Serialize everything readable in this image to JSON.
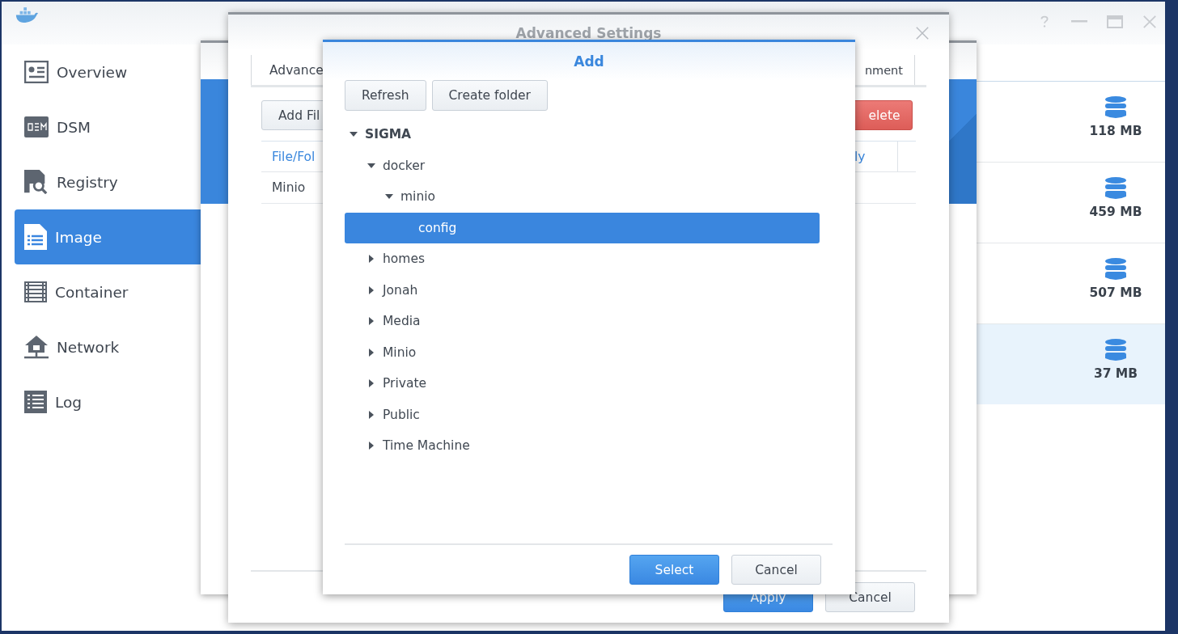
{
  "main_window": {
    "sidebar": {
      "items": [
        {
          "label": "Overview",
          "selected": false
        },
        {
          "label": "DSM",
          "selected": false
        },
        {
          "label": "Registry",
          "selected": false
        },
        {
          "label": "Image",
          "selected": true
        },
        {
          "label": "Container",
          "selected": false
        },
        {
          "label": "Network",
          "selected": false
        },
        {
          "label": "Log",
          "selected": false
        }
      ]
    },
    "images": [
      {
        "size": "118 MB",
        "selected": false
      },
      {
        "size": "459 MB",
        "selected": false
      },
      {
        "size": "507 MB",
        "selected": false
      },
      {
        "size": "37 MB",
        "selected": true
      }
    ]
  },
  "advanced_settings": {
    "title": "Advanced Settings",
    "tabs": [
      "Advance",
      "nment"
    ],
    "toolbar": [
      {
        "label": "Add Fil",
        "kind": "default"
      },
      {
        "label": "elete",
        "kind": "danger"
      }
    ],
    "table": {
      "columns": [
        "File/Fol",
        "ly"
      ],
      "rows": [
        [
          "Minio"
        ]
      ]
    },
    "buttons": [
      {
        "label": "Apply",
        "kind": "primary"
      },
      {
        "label": "Cancel",
        "kind": "default"
      }
    ]
  },
  "add_dialog": {
    "title": "Add",
    "toolbar": [
      "Refresh",
      "Create folder"
    ],
    "tree": [
      {
        "label": "SIGMA",
        "expanded": true,
        "selected": false,
        "children": [
          {
            "label": "docker",
            "expanded": true,
            "selected": false,
            "children": [
              {
                "label": "minio",
                "expanded": true,
                "selected": false,
                "children": [
                  {
                    "label": "config",
                    "selected": true
                  }
                ]
              }
            ]
          },
          {
            "label": "homes",
            "expanded": false,
            "selected": false
          },
          {
            "label": "Jonah",
            "expanded": false,
            "selected": false
          },
          {
            "label": "Media",
            "expanded": false,
            "selected": false
          },
          {
            "label": "Minio",
            "expanded": false,
            "selected": false
          },
          {
            "label": "Private",
            "expanded": false,
            "selected": false
          },
          {
            "label": "Public",
            "expanded": false,
            "selected": false
          },
          {
            "label": "Time Machine",
            "expanded": false,
            "selected": false
          }
        ]
      }
    ],
    "buttons": [
      {
        "label": "Select",
        "kind": "primary"
      },
      {
        "label": "Cancel",
        "kind": "default"
      }
    ]
  }
}
